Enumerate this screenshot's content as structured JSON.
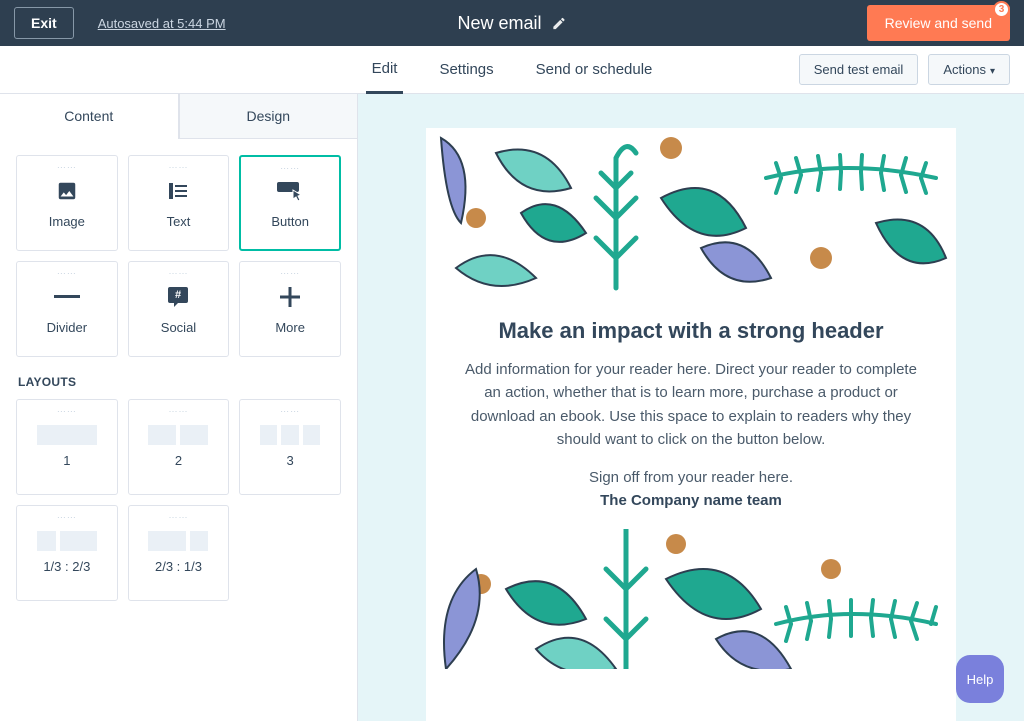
{
  "topbar": {
    "exit": "Exit",
    "autosave": "Autosaved at 5:44 PM",
    "title": "New email",
    "review": "Review and send",
    "badge": "3"
  },
  "subnav": {
    "tabs": [
      "Edit",
      "Settings",
      "Send or schedule"
    ],
    "active": 0,
    "send_test": "Send test email",
    "actions": "Actions"
  },
  "sidebar": {
    "tabs": [
      "Content",
      "Design"
    ],
    "active": 0,
    "modules": [
      {
        "label": "Image"
      },
      {
        "label": "Text"
      },
      {
        "label": "Button",
        "selected": true
      },
      {
        "label": "Divider"
      },
      {
        "label": "Social"
      },
      {
        "label": "More"
      }
    ],
    "layouts_heading": "LAYOUTS",
    "layouts": [
      {
        "label": "1",
        "cols": [
          1
        ]
      },
      {
        "label": "2",
        "cols": [
          1,
          1
        ]
      },
      {
        "label": "3",
        "cols": [
          1,
          1,
          1
        ]
      },
      {
        "label": "1/3 : 2/3",
        "cols": [
          1,
          2
        ]
      },
      {
        "label": "2/3 : 1/3",
        "cols": [
          2,
          1
        ]
      }
    ]
  },
  "email": {
    "headline": "Make an impact with a strong header",
    "body": "Add information for your reader here. Direct your reader to complete an action, whether that is to learn more, purchase a product or download an ebook. Use this space to explain to readers why they should want to click on the button below.",
    "signoff": "Sign off from your reader here.",
    "team": "The Company name team"
  },
  "help": "Help",
  "colors": {
    "accent": "#ff7a53",
    "teal": "#00bda5",
    "navy": "#2e3f50"
  }
}
